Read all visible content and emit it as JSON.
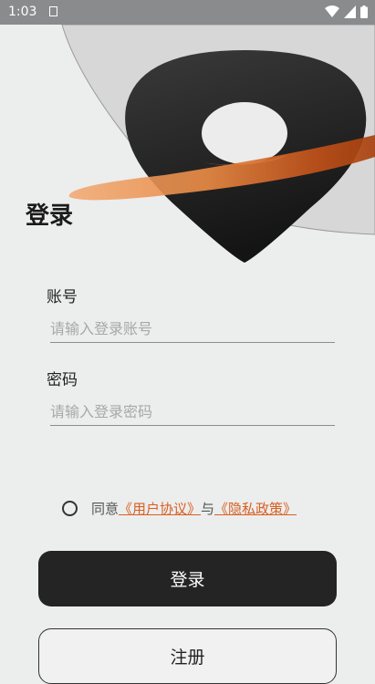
{
  "status_bar": {
    "time": "1:03",
    "icons": [
      "notification-icon",
      "wifi-icon",
      "signal-icon",
      "battery-icon"
    ]
  },
  "page": {
    "title": "登录"
  },
  "account": {
    "label": "账号",
    "placeholder": "请输入登录账号",
    "value": ""
  },
  "password": {
    "label": "密码",
    "placeholder": "请输入登录密码",
    "value": ""
  },
  "agreement": {
    "prefix": "同意",
    "user_agreement": "《用户协议》",
    "conjunction": "与",
    "privacy_policy": "《隐私政策》"
  },
  "buttons": {
    "login": "登录",
    "register": "注册"
  },
  "colors": {
    "accent": "#d85f22",
    "dark": "#242424",
    "background": "#eceded"
  }
}
